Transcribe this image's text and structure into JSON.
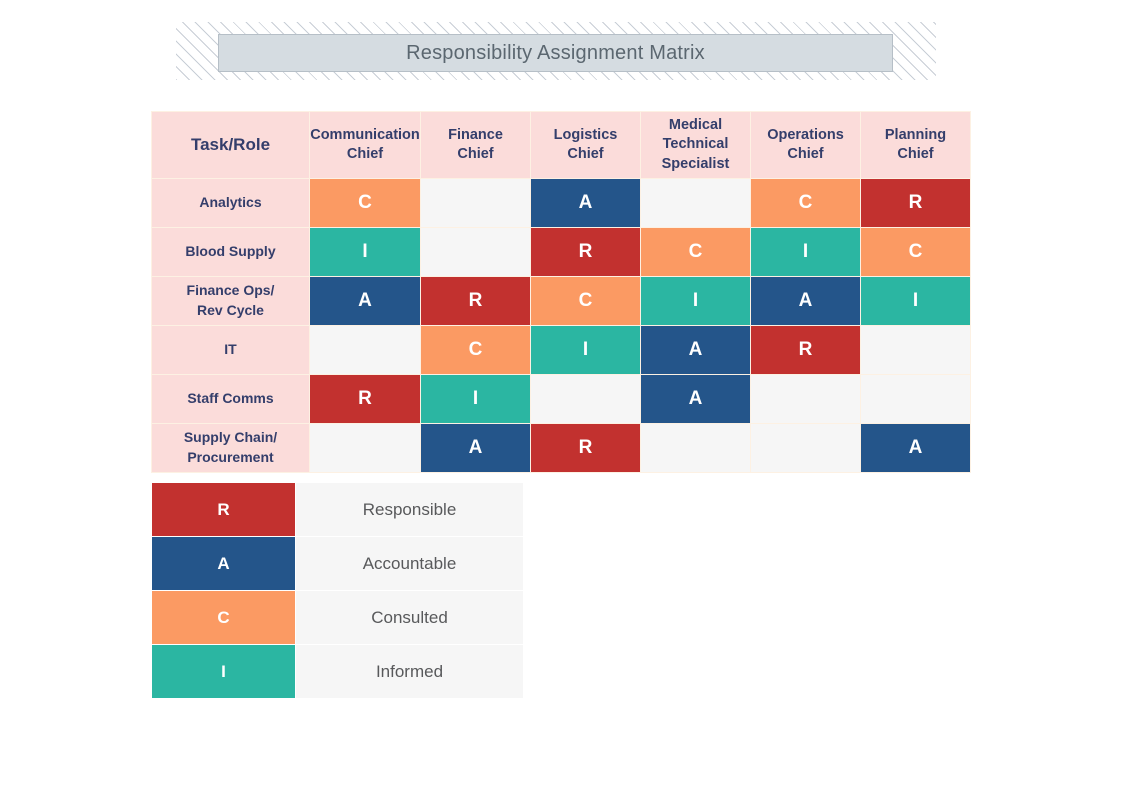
{
  "title": {
    "text": "Responsibility Assignment Matrix"
  },
  "matrix": {
    "corner_label": "Task/Role",
    "columns": [
      "Communication\nChief",
      "Finance\nChief",
      "Logistics\nChief",
      "Medical\nTechnical\nSpecialist",
      "Operations\nChief",
      "Planning\nChief"
    ],
    "columns_flat": [
      "Communication Chief",
      "Finance Chief",
      "Logistics Chief",
      "Medical Technical Specialist",
      "Operations Chief",
      "Planning Chief"
    ],
    "rows": [
      {
        "task": "Analytics",
        "values": [
          "C",
          "",
          "A",
          "",
          "C",
          "R"
        ]
      },
      {
        "task": "Blood Supply",
        "values": [
          "I",
          "",
          "R",
          "C",
          "I",
          "C"
        ]
      },
      {
        "task": "Finance Ops/\nRev Cycle",
        "values": [
          "A",
          "R",
          "C",
          "I",
          "A",
          "I"
        ]
      },
      {
        "task": "IT",
        "values": [
          "",
          "C",
          "I",
          "A",
          "R",
          ""
        ]
      },
      {
        "task": "Staff Comms",
        "values": [
          "R",
          "I",
          "",
          "A",
          "",
          ""
        ]
      },
      {
        "task": "Supply Chain/\nProcurement",
        "values": [
          "",
          "A",
          "R",
          "",
          "",
          "A"
        ]
      }
    ]
  },
  "legend": {
    "items": [
      {
        "key": "R",
        "label": "Responsible"
      },
      {
        "key": "A",
        "label": "Accountable"
      },
      {
        "key": "C",
        "label": "Consulted"
      },
      {
        "key": "I",
        "label": "Informed"
      }
    ]
  },
  "colors": {
    "responsible": "#c2312f",
    "accountable": "#24558a",
    "consulted": "#fb9a63",
    "informed": "#2bb6a2",
    "header_pink": "#fbdcda",
    "empty_cell": "#f6f6f6",
    "header_text": "#343e6b",
    "title_plate": "#d5dce1",
    "title_text": "#5b6770",
    "grid_line": "#fdf1e3"
  }
}
